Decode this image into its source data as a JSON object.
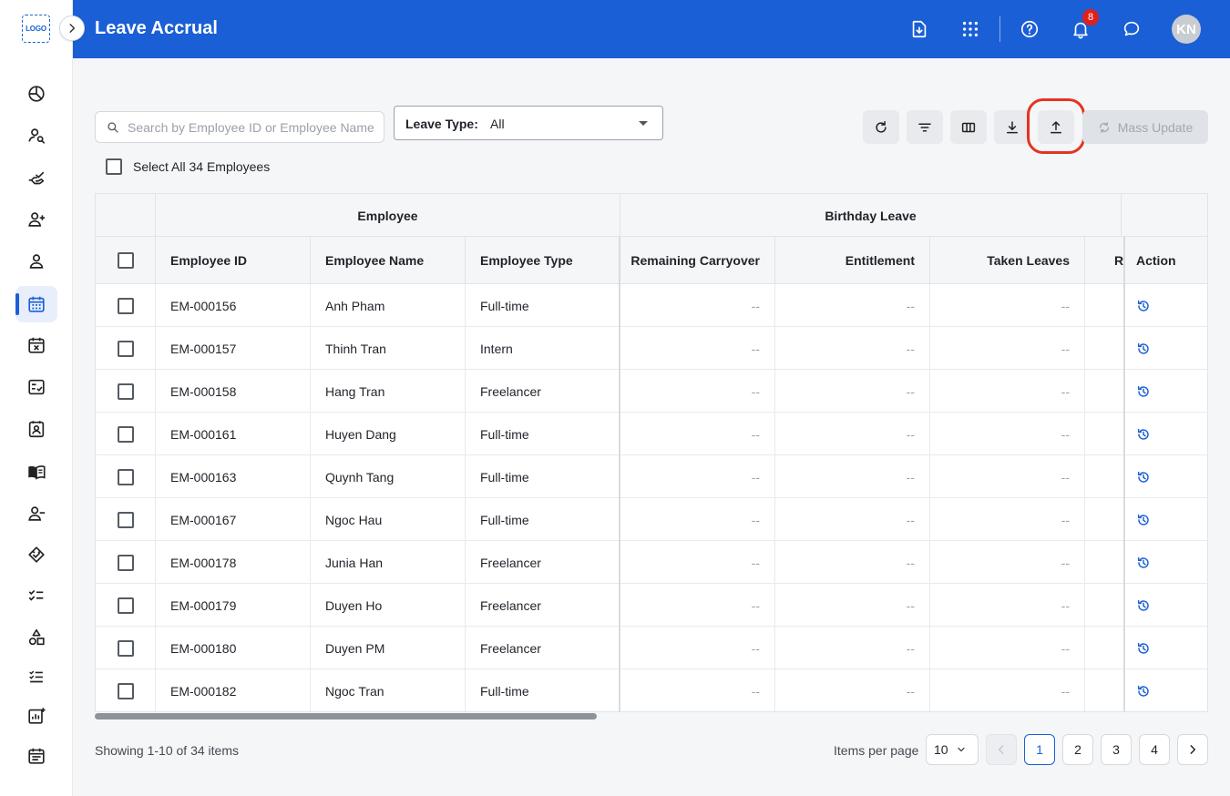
{
  "app": {
    "logo_text": "LOGO",
    "title": "Leave Accrual",
    "notification_count": "8",
    "avatar_initials": "KN"
  },
  "sidebar": {
    "items": [
      {
        "name": "dashboard",
        "icon": "pie-chart-icon",
        "active": false
      },
      {
        "name": "employee-search",
        "icon": "person-search-icon",
        "active": false
      },
      {
        "name": "approvals",
        "icon": "hand-check-icon",
        "active": false
      },
      {
        "name": "add-employee",
        "icon": "person-add-icon",
        "active": false
      },
      {
        "name": "profile",
        "icon": "person-icon",
        "active": false
      },
      {
        "name": "leave-calendar",
        "icon": "calendar-icon",
        "active": true
      },
      {
        "name": "leave-cancel",
        "icon": "calendar-x-icon",
        "active": false
      },
      {
        "name": "checklist",
        "icon": "checklist-icon",
        "active": false
      },
      {
        "name": "contacts",
        "icon": "contact-card-icon",
        "active": false
      },
      {
        "name": "handbook",
        "icon": "book-icon",
        "active": false
      },
      {
        "name": "remove-employee",
        "icon": "person-remove-icon",
        "active": false
      },
      {
        "name": "handshake",
        "icon": "handshake-icon",
        "active": false
      },
      {
        "name": "tasks",
        "icon": "task-list-icon",
        "active": false
      },
      {
        "name": "categories",
        "icon": "shapes-icon",
        "active": false
      },
      {
        "name": "list",
        "icon": "list-icon",
        "active": false
      },
      {
        "name": "reports",
        "icon": "chart-add-icon",
        "active": false
      },
      {
        "name": "events",
        "icon": "event-note-icon",
        "active": false
      }
    ]
  },
  "toolbar": {
    "search_placeholder": "Search by Employee ID or Employee Name",
    "leave_type_label": "Leave Type:",
    "leave_type_value": "All",
    "mass_update_label": "Mass Update",
    "select_all_label": "Select All 34 Employees"
  },
  "table": {
    "group_headers": {
      "employee": "Employee",
      "birthday_leave": "Birthday Leave"
    },
    "columns": {
      "employee_id": "Employee ID",
      "employee_name": "Employee Name",
      "employee_type": "Employee Type",
      "remaining_carryover": "Remaining Carryover",
      "entitlement": "Entitlement",
      "taken_leaves": "Taken Leaves",
      "remaining_partial": "R",
      "action": "Action"
    },
    "rows": [
      {
        "id": "EM-000156",
        "name": "Anh Pham",
        "type": "Full-time",
        "carryover": "--",
        "entitlement": "--",
        "taken": "--"
      },
      {
        "id": "EM-000157",
        "name": "Thinh Tran",
        "type": "Intern",
        "carryover": "--",
        "entitlement": "--",
        "taken": "--"
      },
      {
        "id": "EM-000158",
        "name": "Hang Tran",
        "type": "Freelancer",
        "carryover": "--",
        "entitlement": "--",
        "taken": "--"
      },
      {
        "id": "EM-000161",
        "name": "Huyen Dang",
        "type": "Full-time",
        "carryover": "--",
        "entitlement": "--",
        "taken": "--"
      },
      {
        "id": "EM-000163",
        "name": "Quynh Tang",
        "type": "Full-time",
        "carryover": "--",
        "entitlement": "--",
        "taken": "--"
      },
      {
        "id": "EM-000167",
        "name": "Ngoc Hau",
        "type": "Full-time",
        "carryover": "--",
        "entitlement": "--",
        "taken": "--"
      },
      {
        "id": "EM-000178",
        "name": "Junia Han",
        "type": "Freelancer",
        "carryover": "--",
        "entitlement": "--",
        "taken": "--"
      },
      {
        "id": "EM-000179",
        "name": "Duyen Ho",
        "type": "Freelancer",
        "carryover": "--",
        "entitlement": "--",
        "taken": "--"
      },
      {
        "id": "EM-000180",
        "name": "Duyen PM",
        "type": "Freelancer",
        "carryover": "--",
        "entitlement": "--",
        "taken": "--"
      },
      {
        "id": "EM-000182",
        "name": "Ngoc Tran",
        "type": "Full-time",
        "carryover": "--",
        "entitlement": "--",
        "taken": "--"
      }
    ]
  },
  "footer": {
    "showing_text": "Showing 1-10 of 34 items",
    "items_per_page_label": "Items per page",
    "items_per_page_value": "10",
    "pages": [
      "1",
      "2",
      "3",
      "4"
    ],
    "current_page": "1"
  },
  "colors": {
    "brand": "#1a5fd6",
    "highlight": "#e53322",
    "badge": "#e0201c"
  }
}
